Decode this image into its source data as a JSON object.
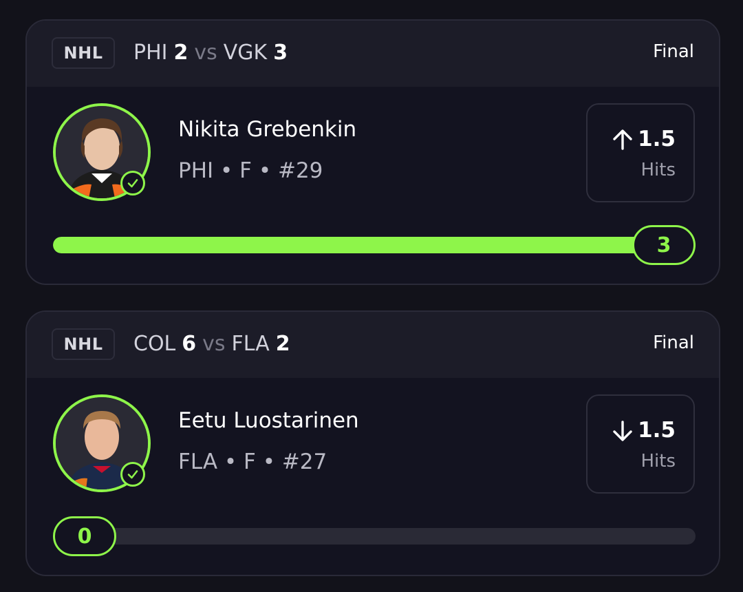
{
  "cards": [
    {
      "league": "NHL",
      "away_team": "PHI",
      "away_score": "2",
      "vs": "vs",
      "home_team": "VGK",
      "home_score": "3",
      "status": "Final",
      "player": {
        "name": "Nikita Grebenkin",
        "info": "PHI • F • #29"
      },
      "prop": {
        "direction": "over",
        "line": "1.5",
        "stat": "Hits"
      },
      "result": {
        "value": "3",
        "progress": 1.0
      },
      "jersey_color": "#1c1c1c",
      "jersey_accent": "#f26b1d"
    },
    {
      "league": "NHL",
      "away_team": "COL",
      "away_score": "6",
      "vs": "vs",
      "home_team": "FLA",
      "home_score": "2",
      "status": "Final",
      "player": {
        "name": "Eetu Luostarinen",
        "info": "FLA • F • #27"
      },
      "prop": {
        "direction": "under",
        "line": "1.5",
        "stat": "Hits"
      },
      "result": {
        "value": "0",
        "progress": 0.0
      },
      "jersey_color": "#1b2a4a",
      "jersey_accent": "#e4761c"
    }
  ],
  "colors": {
    "accent": "#8ef54a",
    "background": "#12121a",
    "card": "#131320",
    "header": "#1c1c28"
  }
}
